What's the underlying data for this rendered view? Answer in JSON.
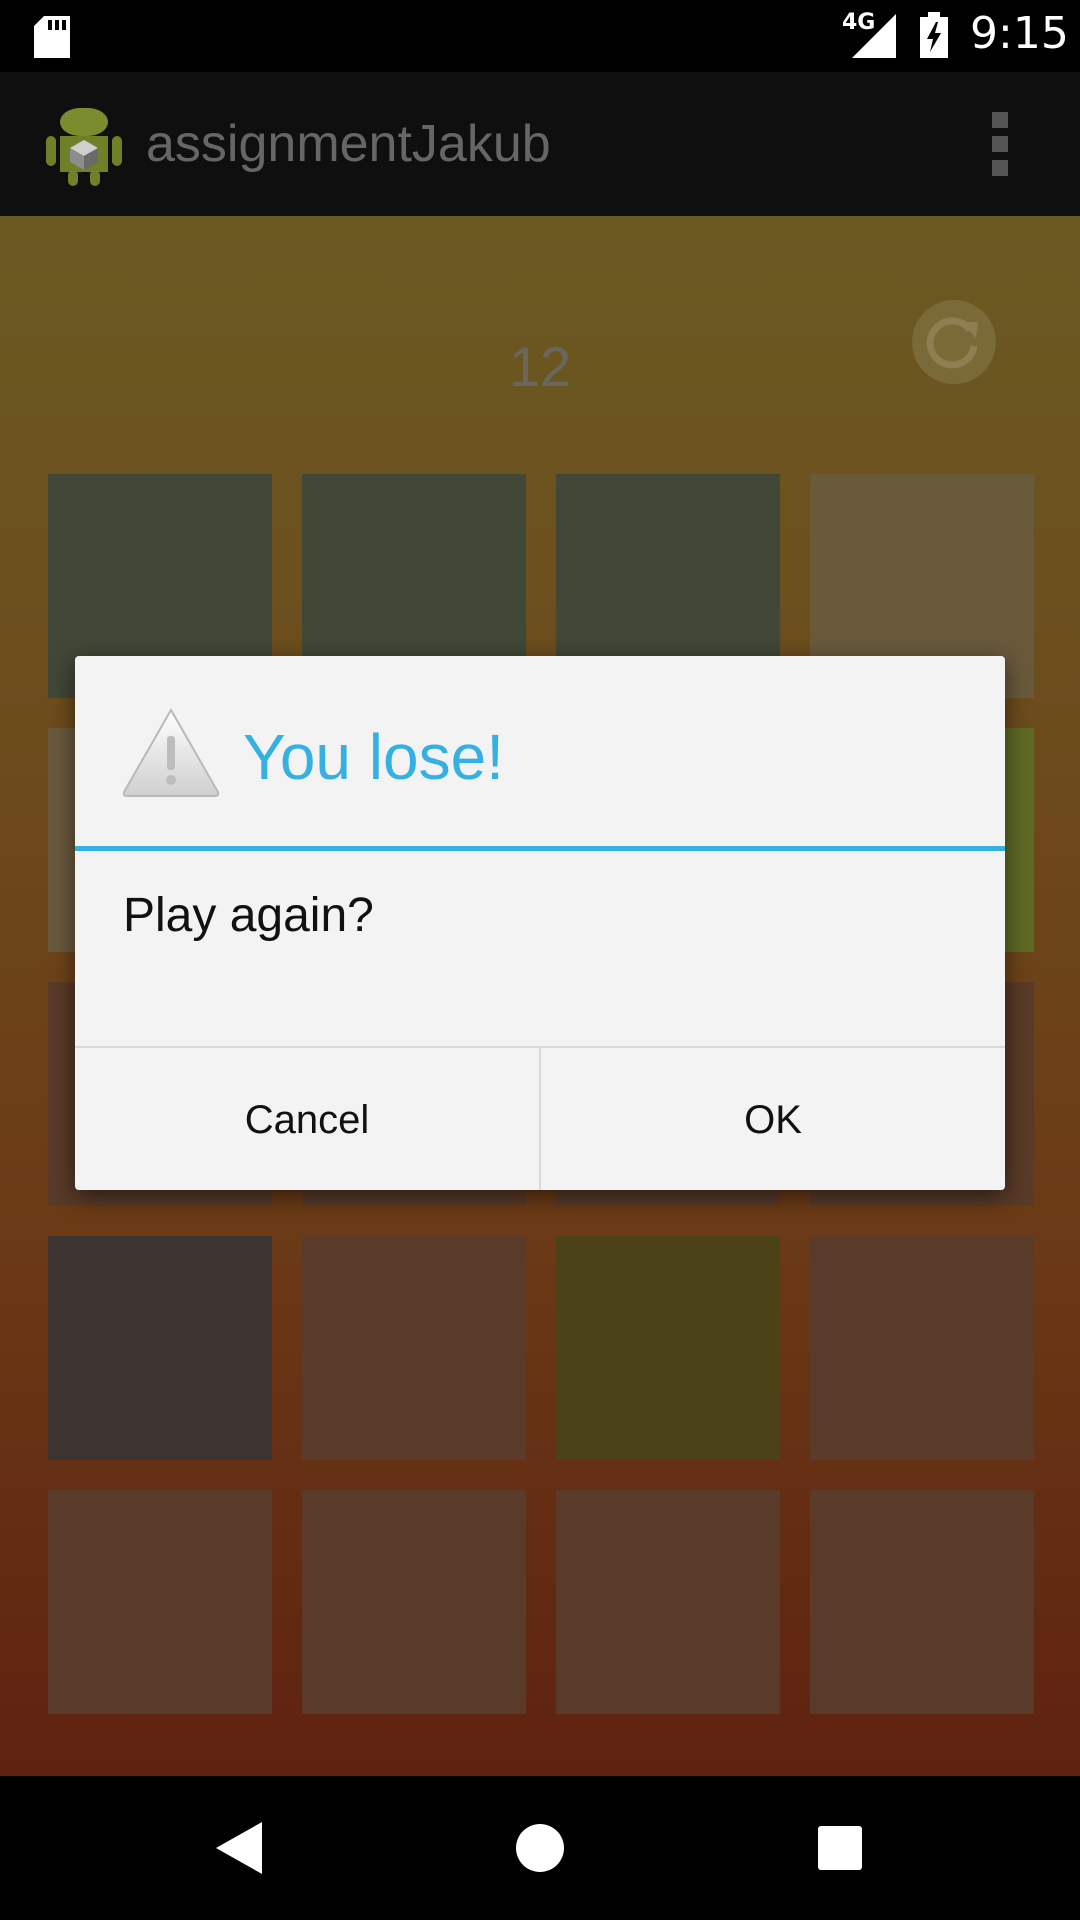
{
  "status_bar": {
    "network": "4G",
    "time": "9:15",
    "icons": [
      "sd-card-icon",
      "signal-icon",
      "battery-charging-icon"
    ]
  },
  "action_bar": {
    "title": "assignmentJakub",
    "icons": [
      "android-app-icon",
      "overflow-menu-icon"
    ]
  },
  "game": {
    "score": "12",
    "refresh_icon": "refresh-icon"
  },
  "dialog": {
    "title": "You lose!",
    "message": "Play again?",
    "cancel_label": "Cancel",
    "ok_label": "OK",
    "icon": "warning-icon",
    "accent": "#35b0e3"
  },
  "nav_bar": {
    "icons": [
      "back-icon",
      "home-icon",
      "recents-icon"
    ]
  }
}
